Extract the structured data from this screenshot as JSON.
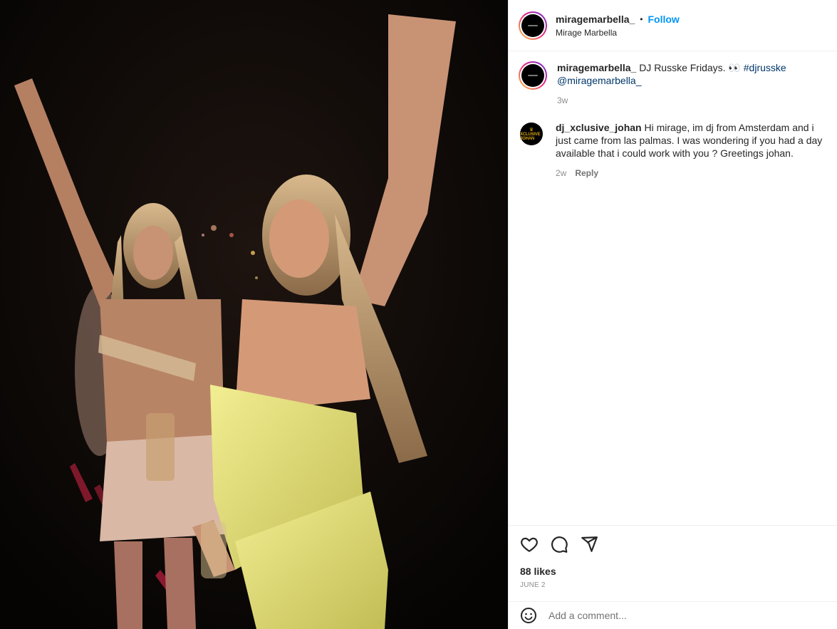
{
  "post": {
    "image": {
      "description_icon": "party-photo",
      "colors": {
        "background": "#0a0806",
        "dress": "#e6e27a",
        "skin": "#c89274",
        "hair": "#c9a67a"
      }
    },
    "header": {
      "username": "miragemarbella_",
      "separator": "•",
      "follow_label": "Follow",
      "location": "Mirage Marbella"
    },
    "caption": {
      "username": "miragemarbella_",
      "text": "DJ Russke Fridays. 👀",
      "hashtag": "#djrusske",
      "mention": "@miragemarbella_",
      "time": "3w"
    },
    "comments": [
      {
        "username": "dj_xclusive_johan",
        "avatar_text": "XCLUSIVE JOHAN",
        "text": "Hi mirage, im dj from Amsterdam and i just came from las palmas. I was wondering if you had a day available that i could work with you ? Greetings johan.",
        "time": "2w",
        "reply_label": "Reply"
      }
    ],
    "actions": {
      "icons": [
        "heart-icon",
        "comment-icon",
        "share-icon"
      ],
      "likes": "88 likes",
      "date": "JUNE 2"
    },
    "add_comment": {
      "icon": "emoji-icon",
      "placeholder": "Add a comment..."
    },
    "accent_color": "#0095f6"
  }
}
